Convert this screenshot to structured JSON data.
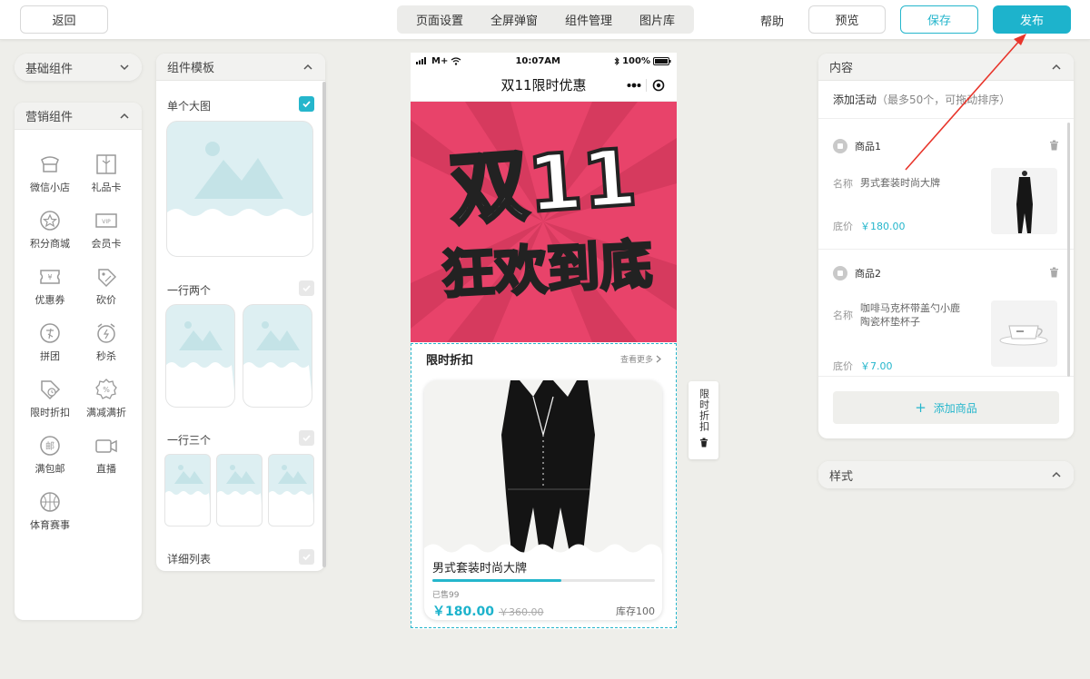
{
  "topbar": {
    "back": "返回",
    "tabs": [
      "页面设置",
      "全屏弹窗",
      "组件管理",
      "图片库"
    ],
    "help": "帮助",
    "preview": "预览",
    "save": "保存",
    "publish": "发布"
  },
  "basic": {
    "title": "基础组件"
  },
  "marketing": {
    "title": "营销组件",
    "items": [
      "微信小店",
      "礼品卡",
      "积分商城",
      "会员卡",
      "优惠券",
      "砍价",
      "拼团",
      "秒杀",
      "限时折扣",
      "满减满折",
      "满包邮",
      "直播",
      "体育赛事"
    ]
  },
  "templates": {
    "title": "组件模板",
    "single": "单个大图",
    "two": "一行两个",
    "three": "一行三个",
    "list": "详细列表"
  },
  "phone": {
    "carrier": "M+",
    "time": "10:07AM",
    "battery": "100%",
    "title": "双11限时优惠",
    "banner_line1": "双11",
    "banner_line2": "狂欢到底",
    "flash_title": "限时折扣",
    "flash_more": "查看更多",
    "product_name": "男式套装时尚大牌",
    "sold": "已售99",
    "sold_progress": 0.58,
    "price": "￥180.00",
    "orig_price": "￥360.00",
    "stock": "库存100"
  },
  "side_tag": {
    "label": "限时折扣"
  },
  "content": {
    "title": "内容",
    "add_activity": "添加活动",
    "add_activity_hint": "（最多50个，可拖动排序）",
    "goods": [
      {
        "title": "商品1",
        "name_label": "名称",
        "name": "男式套装时尚大牌",
        "price_label": "底价",
        "price": "￥180.00"
      },
      {
        "title": "商品2",
        "name_label": "名称",
        "name": "咖啡马克杯带盖勺小鹿陶瓷杯垫杯子",
        "price_label": "底价",
        "price": "￥7.00"
      }
    ],
    "add_goods": "添加商品"
  },
  "style": {
    "title": "样式"
  },
  "colors": {
    "accent": "#1db3cc",
    "banner": "#e8436a"
  }
}
